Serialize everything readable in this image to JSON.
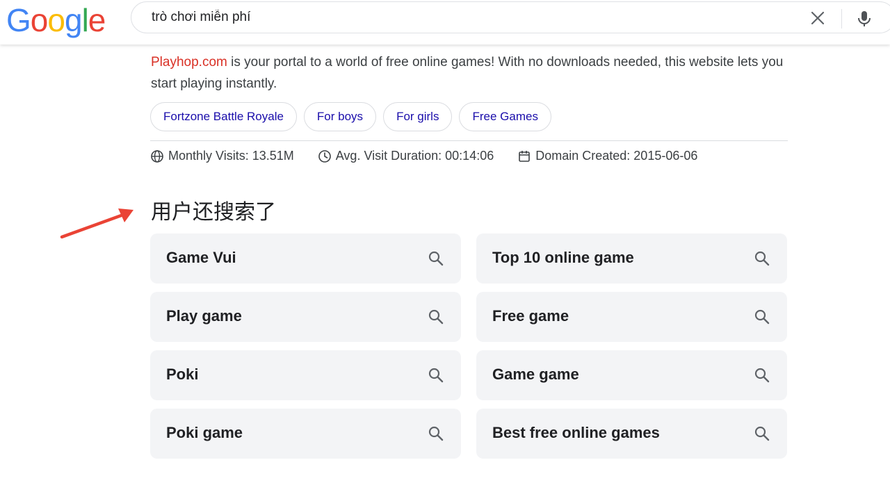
{
  "header": {
    "logo_letters": [
      "G",
      "o",
      "o",
      "g",
      "l",
      "e"
    ],
    "search": {
      "value": "trò chơi miễn phí"
    },
    "icons": {
      "clear": "close-icon",
      "voice": "microphone-icon"
    }
  },
  "result": {
    "site_link": "Playhop.com",
    "snippet_rest": " is your portal to a world of free online games! With no downloads needed, this website lets you start playing instantly.",
    "chips": [
      {
        "label": "Fortzone Battle Royale"
      },
      {
        "label": "For boys"
      },
      {
        "label": "For girls"
      },
      {
        "label": "Free Games"
      }
    ],
    "stats": [
      {
        "icon": "globe-icon",
        "text": "Monthly Visits: 13.51M"
      },
      {
        "icon": "clock-icon",
        "text": "Avg. Visit Duration: 00:14:06"
      },
      {
        "icon": "calendar-icon",
        "text": "Domain Created: 2015-06-06"
      }
    ]
  },
  "related": {
    "heading": "用户还搜索了",
    "annotation_color": "#ea4335",
    "items": [
      {
        "label": "Game Vui"
      },
      {
        "label": "Top 10 online game"
      },
      {
        "label": "Play game"
      },
      {
        "label": "Free game"
      },
      {
        "label": "Poki"
      },
      {
        "label": "Game game"
      },
      {
        "label": "Poki game"
      },
      {
        "label": "Best free online games"
      }
    ]
  },
  "colors": {
    "link": "#1a0dab",
    "site": "#d93025",
    "chip_border": "#dadce0",
    "related_bg": "#f3f4f6"
  }
}
